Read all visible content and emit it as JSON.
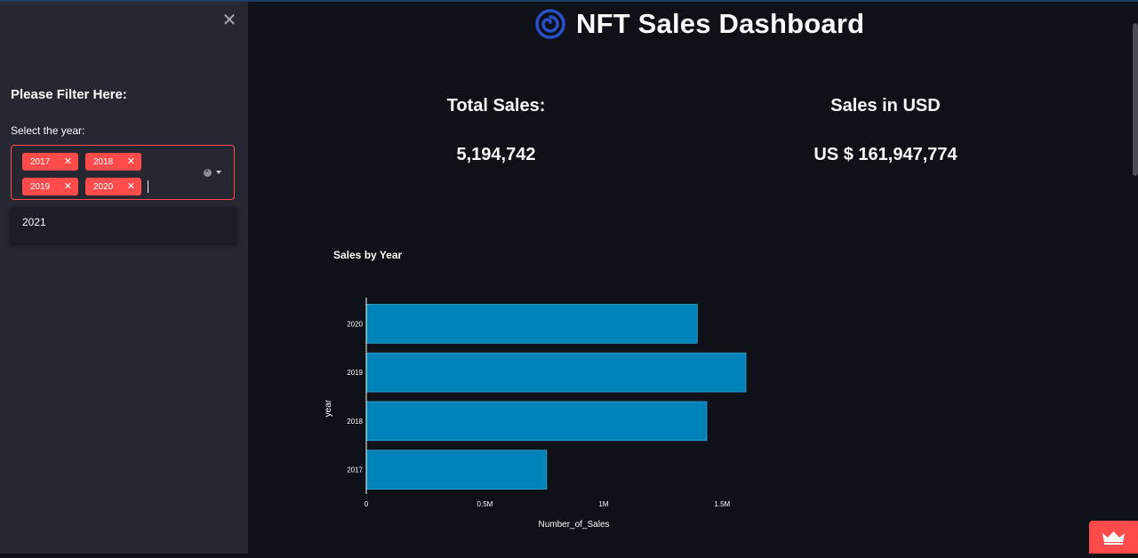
{
  "sidebar": {
    "close_icon": "close-icon",
    "filter_title": "Please Filter Here:",
    "select_label": "Select the year:",
    "selected_tags": [
      "2017",
      "2018",
      "2019",
      "2020"
    ],
    "dropdown_options": [
      "2021"
    ],
    "accent_color": "#ff4b4b"
  },
  "header": {
    "logo_icon": "spiral-icon",
    "title": "NFT Sales Dashboard"
  },
  "kpis": {
    "total_sales_label": "Total Sales:",
    "total_sales_value": "5,194,742",
    "sales_usd_label": "Sales in USD",
    "sales_usd_value": "US $ 161,947,774"
  },
  "chart_data": {
    "type": "bar",
    "orientation": "horizontal",
    "title": "Sales by Year",
    "xlabel": "Number_of_Sales",
    "ylabel": "year",
    "categories": [
      "2017",
      "2018",
      "2019",
      "2020"
    ],
    "values": [
      760000,
      1435000,
      1600000,
      1395000
    ],
    "xlim": [
      0,
      1600000
    ],
    "xticks": [
      0,
      500000,
      1000000,
      1500000
    ],
    "xtick_labels": [
      "0",
      "0.5M",
      "1M",
      "1.5M"
    ],
    "bar_color": "#0083b8",
    "grid": false
  },
  "deploy": {
    "icon": "crown-icon"
  }
}
